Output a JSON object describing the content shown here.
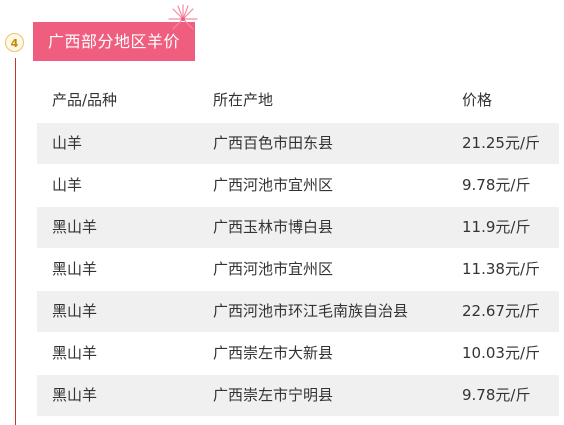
{
  "section": {
    "step_number": "4",
    "title": "广西部分地区羊价"
  },
  "table": {
    "headers": [
      "产品/品种",
      "所在产地",
      "价格"
    ],
    "rows": [
      [
        "山羊",
        "广西百色市田东县",
        "21.25元/斤"
      ],
      [
        "山羊",
        "广西河池市宜州区",
        "9.78元/斤"
      ],
      [
        "黑山羊",
        "广西玉林市博白县",
        "11.9元/斤"
      ],
      [
        "黑山羊",
        "广西河池市宜州区",
        "11.38元/斤"
      ],
      [
        "黑山羊",
        "广西河池市环江毛南族自治县",
        "22.67元/斤"
      ],
      [
        "黑山羊",
        "广西崇左市大新县",
        "10.03元/斤"
      ],
      [
        "黑山羊",
        "广西崇左市宁明县",
        "9.78元/斤"
      ]
    ]
  },
  "colors": {
    "banner": "#ef5e7f",
    "timeline": "#c0392b",
    "row_shade": "#f0f0f0",
    "step_border": "#e9c46a"
  }
}
